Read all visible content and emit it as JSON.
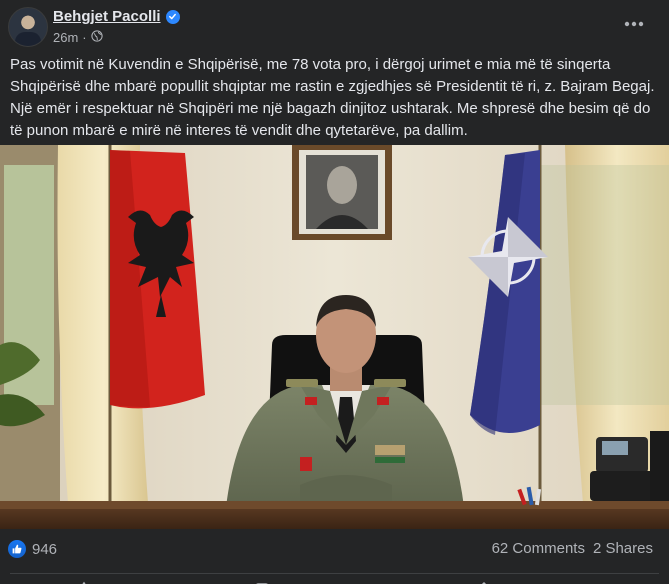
{
  "post": {
    "author_name": "Behgjet Pacolli",
    "timestamp": "26m",
    "text": "Pas votimit në Kuvendin e Shqipërisë, me 78 vota pro, i dërgoj urimet e mia më të sinqerta Shqipërisë dhe mbarë popullit shqiptar me rastin e zgjedhjes së Presidentit të ri, z. Bajram Begaj. Një emër i respektuar në Shqipëri me një bagazh dinjitoz ushtarak. Me shpresë dhe besim që do të punon mbarë e mirë në interes të vendit dhe qytetarëve, pa dallim."
  },
  "stats": {
    "reaction_count": "946",
    "comments": "62 Comments",
    "shares": "2 Shares"
  },
  "icons": {
    "verified": "verified-badge-icon",
    "privacy": "globe-icon",
    "more": "more-options-icon",
    "reaction": "like-icon"
  },
  "colors": {
    "background": "#242526",
    "text": "#e4e6eb",
    "secondary_text": "#b0b3b8",
    "accent": "#2d88ff",
    "like_blue": "#1877f2"
  }
}
